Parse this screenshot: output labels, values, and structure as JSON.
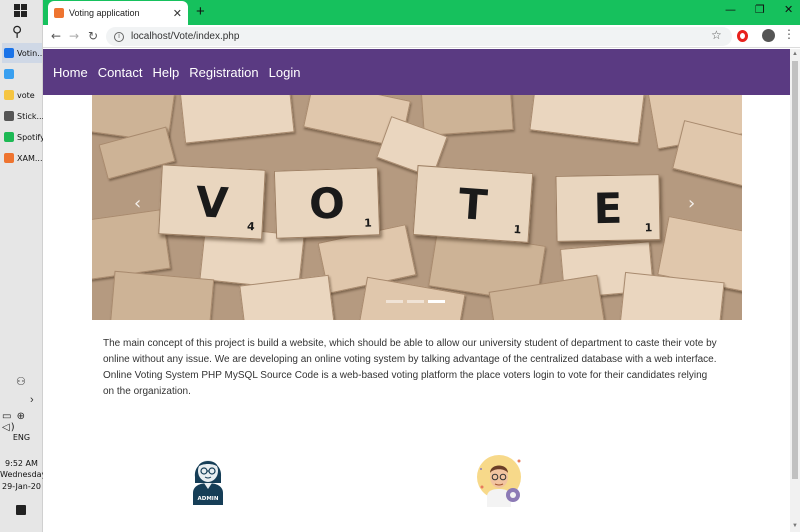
{
  "taskbar": {
    "apps": [
      {
        "label": "Votin...",
        "color": "#1a73e8",
        "active": true
      },
      {
        "label": "",
        "color": "#3aa0f0",
        "active": false
      },
      {
        "label": "vote",
        "color": "#f5c542",
        "active": false
      },
      {
        "label": "Stick...",
        "color": "#555555",
        "active": false
      },
      {
        "label": "Spotify",
        "color": "#1db954",
        "active": false
      },
      {
        "label": "XAM...",
        "color": "#ee7430",
        "active": false
      }
    ],
    "language": "ENG",
    "time": "9:52 AM",
    "day": "Wednesday",
    "date": "29-Jan-20"
  },
  "browser": {
    "tab_title": "Voting application",
    "url": "localhost/Vote/index.php",
    "titlebar_color": "#16c15d"
  },
  "nav": {
    "bg_color": "#5a3a82",
    "links": [
      "Home",
      "Contact",
      "Help",
      "Registration",
      "Login"
    ]
  },
  "carousel": {
    "letters": [
      {
        "letter": "V",
        "score": "4"
      },
      {
        "letter": "O",
        "score": "1"
      },
      {
        "letter": "T",
        "score": "1"
      },
      {
        "letter": "E",
        "score": "1"
      }
    ],
    "slide_count": 3,
    "active_slide": 3,
    "prev_icon": "chevron-left-icon",
    "next_icon": "chevron-right-icon"
  },
  "description": "The main concept of this project is build a website, which should be able to allow our university student of department to caste their vote by online without any issue. We are developing an online voting system by talking advantage of the centralized database with a web interface. Online Voting System PHP MySQL Source Code is a web-based voting platform the place voters login to vote for their candidates relying on the organization.",
  "features": {
    "admin_label": "ADMIN"
  }
}
